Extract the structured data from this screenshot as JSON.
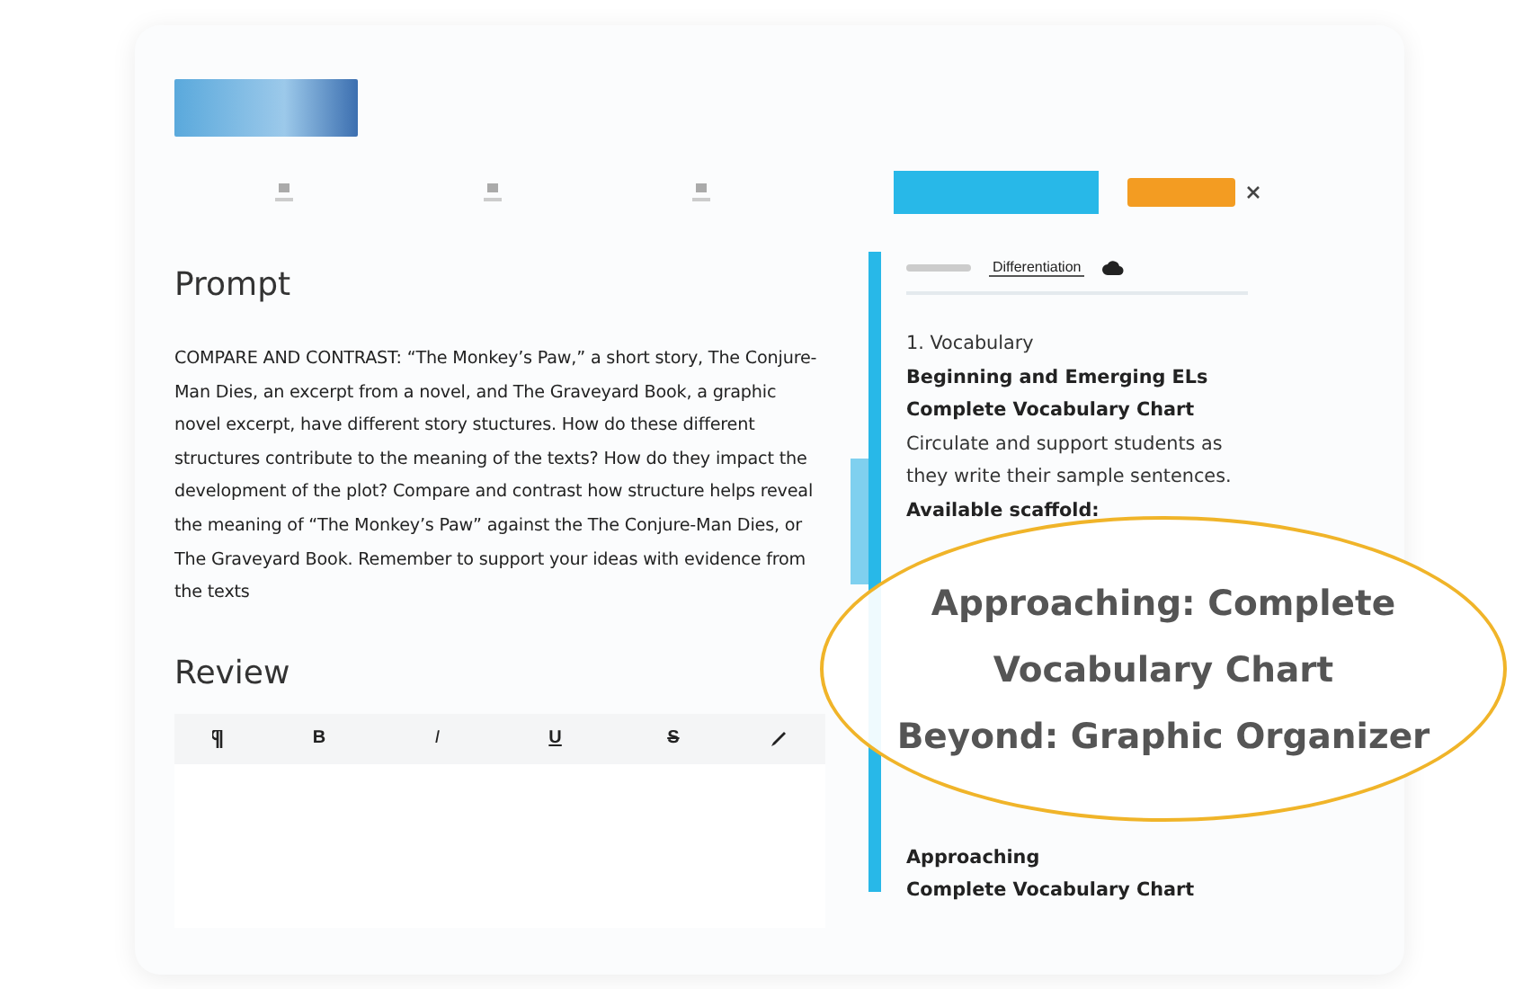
{
  "prompt": {
    "heading": "Prompt",
    "text": "COMPARE AND CONTRAST: “The Monkey’s Paw,” a short story, The Conjure-Man Dies, an excerpt from a novel, and The Graveyard Book, a graphic novel excerpt, have different story stuctures. How do these different structures contribute to the meaning of the texts? How do they impact the development of the plot? Compare and contrast how structure helps reveal the meaning of “The Monkey’s Paw” against the The Conjure-Man Dies, or The Graveyard Book. Remember to support your ideas with evidence from the texts"
  },
  "review": {
    "heading": "Review",
    "tools": [
      {
        "kind": "paragraph"
      },
      {
        "kind": "bold",
        "label": "B"
      },
      {
        "kind": "italic",
        "label": "I"
      },
      {
        "kind": "underline",
        "label": "U"
      },
      {
        "kind": "strike",
        "label": "S"
      },
      {
        "kind": "pen"
      }
    ]
  },
  "panel": {
    "tabs": [
      {
        "label": "Differentiation",
        "selected": true
      }
    ],
    "items": [
      {
        "kind": "plain",
        "text": "1. Vocabulary"
      },
      {
        "kind": "bold",
        "text": "Beginning and Emerging ELs"
      },
      {
        "kind": "bold",
        "text": "Complete Vocabulary Chart"
      },
      {
        "kind": "plain",
        "text": "Circulate and support students as they write their sample sentences."
      },
      {
        "kind": "bold",
        "text": "Available scaffold:"
      },
      {
        "kind": "spacer"
      },
      {
        "kind": "bold",
        "text": "Approaching"
      },
      {
        "kind": "bold",
        "text": "Complete Vocabulary Chart"
      }
    ]
  },
  "callout": {
    "lines": [
      "Approaching: Complete",
      "Vocabulary Chart",
      "Beyond: Graphic Organizer"
    ]
  }
}
